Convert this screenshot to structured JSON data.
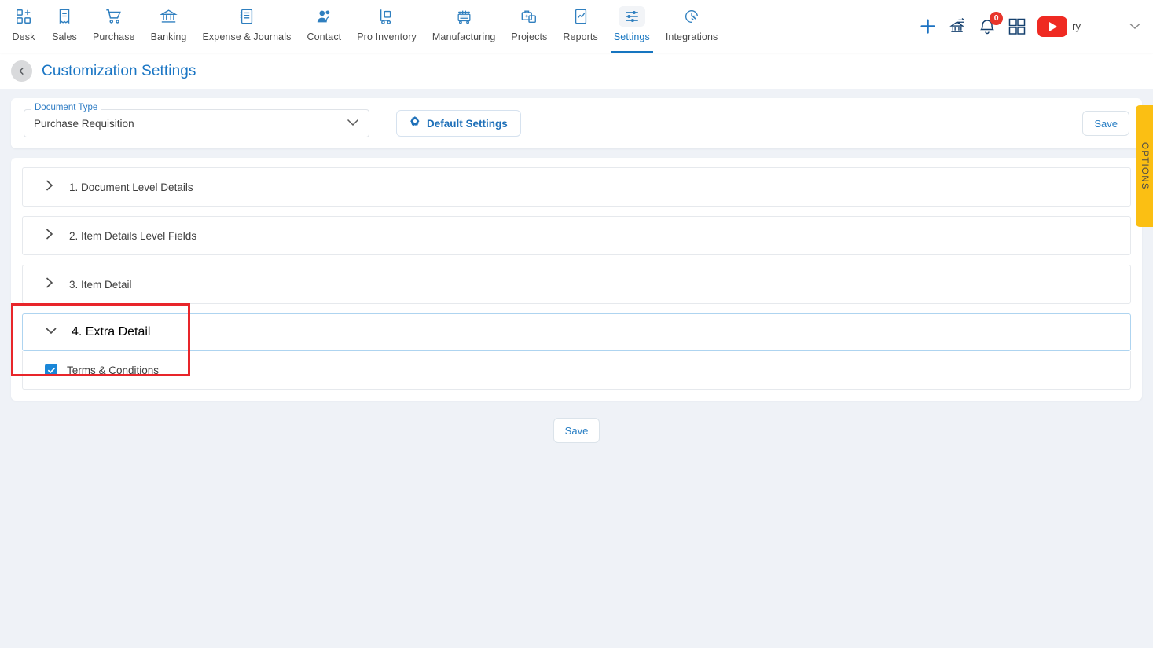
{
  "topnav": {
    "items": [
      {
        "label": "Desk",
        "icon": "dashboard-grid-plus-icon",
        "active": false
      },
      {
        "label": "Sales",
        "icon": "receipt-icon",
        "active": false
      },
      {
        "label": "Purchase",
        "icon": "shopping-cart-icon",
        "active": false
      },
      {
        "label": "Banking",
        "icon": "bank-icon",
        "active": false
      },
      {
        "label": "Expense & Journals",
        "icon": "notebook-icon",
        "active": false
      },
      {
        "label": "Contact",
        "icon": "people-icon",
        "active": false
      },
      {
        "label": "Pro Inventory",
        "icon": "hand-truck-icon",
        "active": false
      },
      {
        "label": "Manufacturing",
        "icon": "factory-machine-icon",
        "active": false
      },
      {
        "label": "Projects",
        "icon": "briefcase-icon",
        "active": false
      },
      {
        "label": "Reports",
        "icon": "chart-document-icon",
        "active": false
      },
      {
        "label": "Settings",
        "icon": "sliders-icon",
        "active": true
      },
      {
        "label": "Integrations",
        "icon": "plug-circle-icon",
        "active": false
      }
    ],
    "right": {
      "add_icon": "plus-icon",
      "bank_transfer_icon": "bank-transfer-icon",
      "notifications_icon": "bell-icon",
      "notifications_count": "0",
      "apps_icon": "apps-grid-icon",
      "video_icon": "youtube-play-icon",
      "user_label": "ry",
      "chevron_icon": "chevron-down-icon"
    }
  },
  "header": {
    "back_icon": "chevron-left-icon",
    "title": "Customization Settings"
  },
  "toolbar": {
    "document_type": {
      "label": "Document Type",
      "value": "Purchase Requisition",
      "chevron_icon": "chevron-down-icon"
    },
    "default_settings": {
      "label": "Default Settings",
      "icon": "gear-icon"
    },
    "save_label": "Save"
  },
  "sections": [
    {
      "title": "1. Document Level Details",
      "expanded": false,
      "chevron_icon": "chevron-right-icon"
    },
    {
      "title": "2. Item Details Level Fields",
      "expanded": false,
      "chevron_icon": "chevron-right-icon"
    },
    {
      "title": "3. Item Detail",
      "expanded": false,
      "chevron_icon": "chevron-right-icon"
    },
    {
      "title": "4. Extra Detail",
      "expanded": true,
      "chevron_icon": "chevron-down-icon"
    }
  ],
  "extra_detail": {
    "checkbox_label": "Terms & Conditions",
    "checkbox_checked": true,
    "check_icon": "check-icon"
  },
  "bottom": {
    "save_label": "Save"
  },
  "options_tab": {
    "label": "OPTIONS"
  },
  "colors": {
    "accent_blue": "#1b76c4",
    "page_bg": "#eff2f7",
    "checkbox_blue": "#1a87d8",
    "annotation_red": "#e8252a",
    "options_yellow": "#fbbf13",
    "badge_red": "#e8352b",
    "youtube_red": "#ef2a22"
  }
}
